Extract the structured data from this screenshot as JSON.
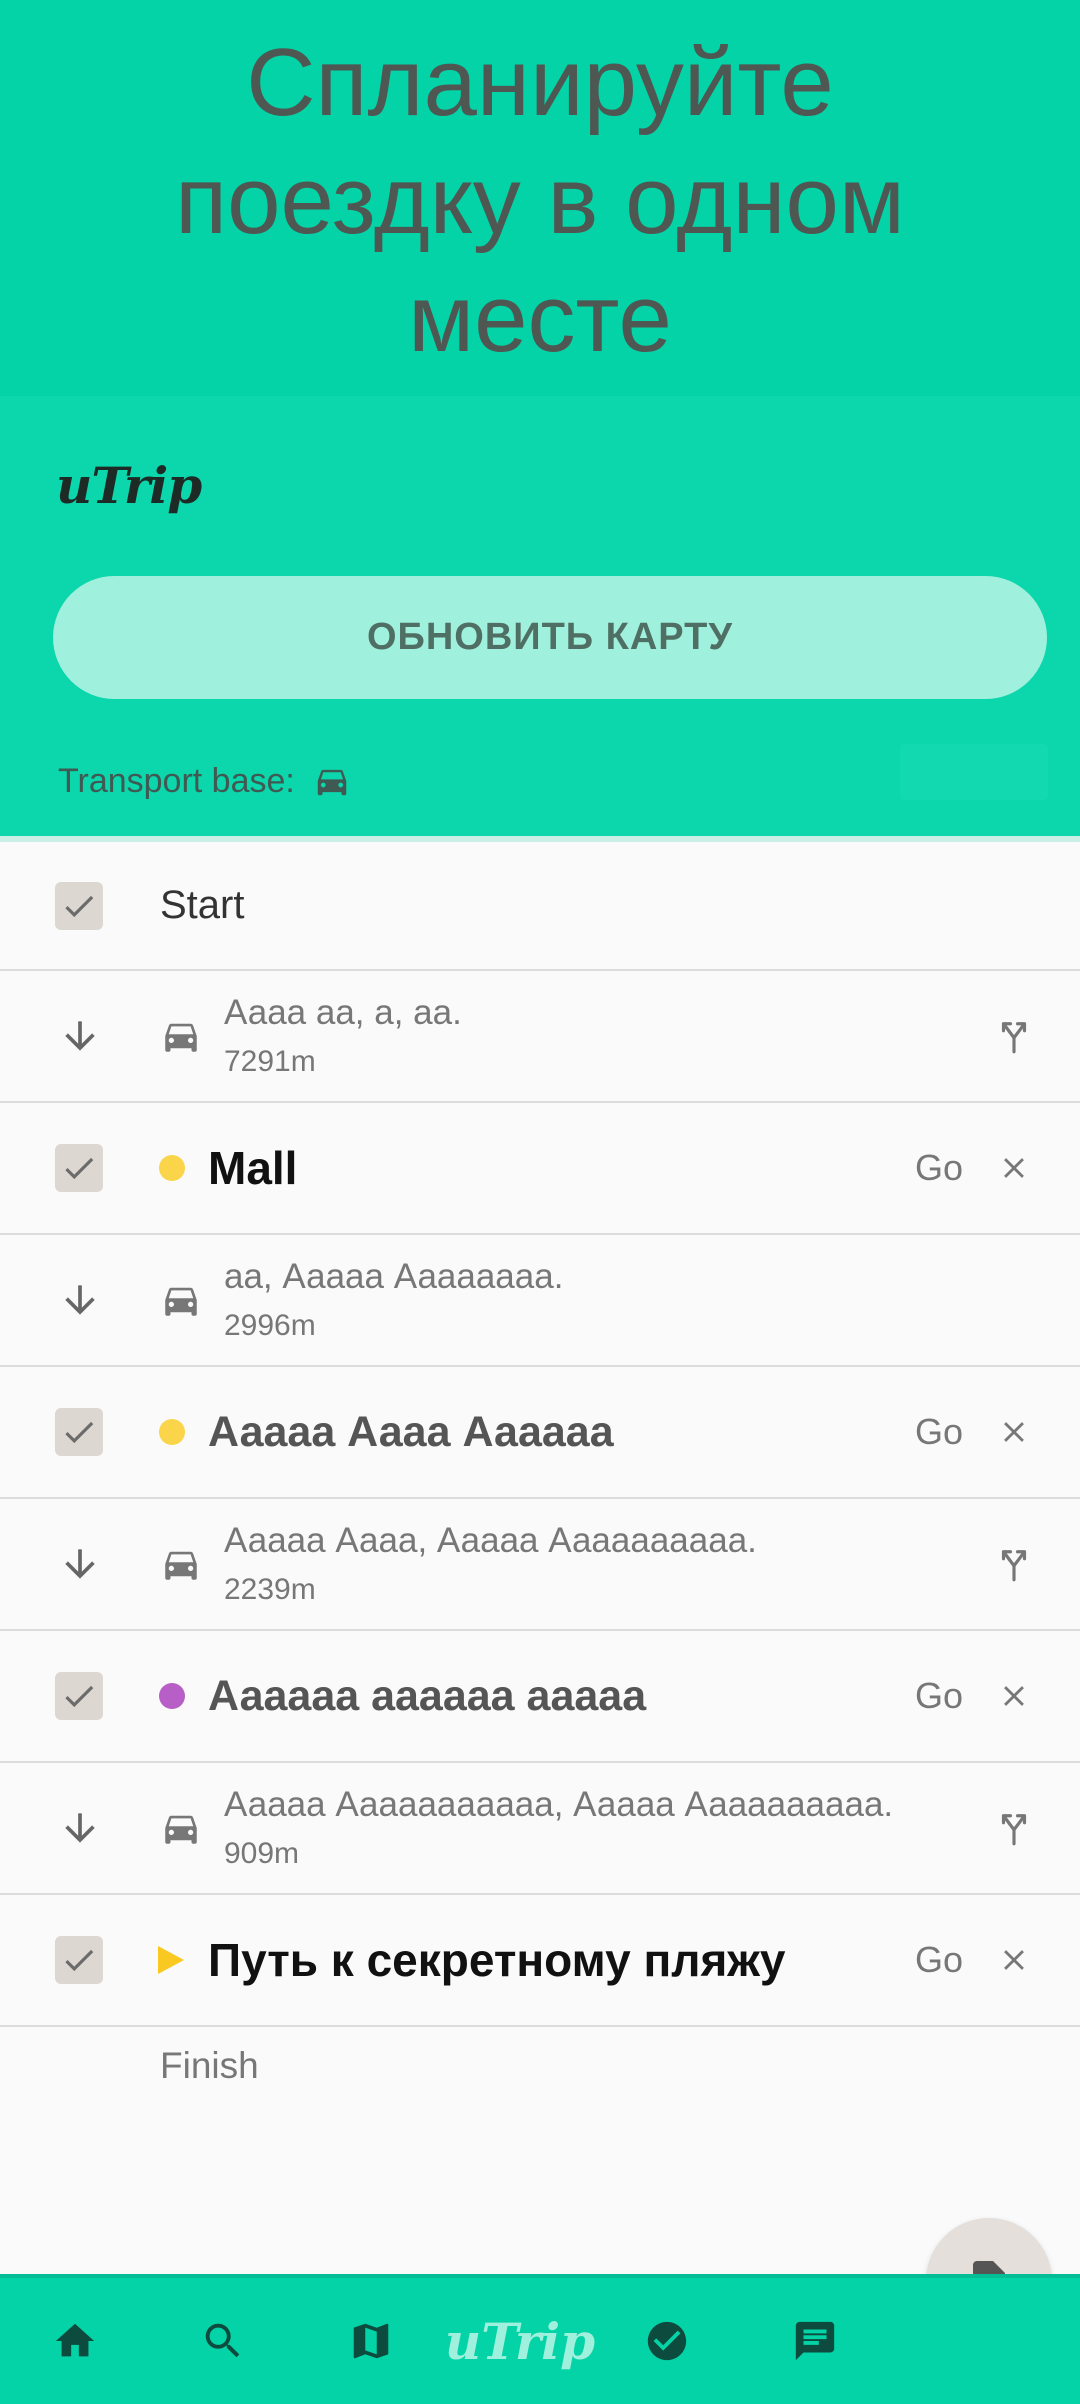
{
  "hero": {
    "title": "Спланируйте поездку в одном месте"
  },
  "header": {
    "logo": "uTrip",
    "update_button": "ОБНОВИТЬ КАРТУ",
    "transport_label": "Transport base:",
    "transport_icon": "car-icon"
  },
  "list": {
    "start": "Start",
    "finish": "Finish",
    "stops": [
      {
        "name": "Mall",
        "marker": "dot",
        "color": "#fad54a",
        "go": "Go"
      },
      {
        "name": "Ааааа Аааа Аааааа",
        "marker": "dot",
        "color": "#fad54a",
        "go": "Go"
      },
      {
        "name": "Аааааа аааааа ааааа",
        "marker": "dot",
        "color": "#b75fc6",
        "go": "Go"
      },
      {
        "name": "Путь к секретному пляжу",
        "marker": "flag",
        "color": "#f9c821",
        "go": "Go"
      }
    ],
    "legs": [
      {
        "desc": "Аааа аа, а, аа.",
        "dist": "7291m",
        "has_fork": true
      },
      {
        "desc": "аа, Ааааа Аааааааа.",
        "dist": "2996m",
        "has_fork": false
      },
      {
        "desc": "Ааааа Аааа, Ааааа Аааааааааа.",
        "dist": "2239m",
        "has_fork": true
      },
      {
        "desc": "Ааааа Ааааааааааа, Ааааа Аааааааааа.",
        "dist": "909m",
        "has_fork": true
      }
    ]
  },
  "bottom_nav": {
    "items": [
      "home-icon",
      "search-icon",
      "map-icon",
      "utrip-logo",
      "check-circle-icon",
      "chat-icon"
    ],
    "logo": "uTrip"
  },
  "colors": {
    "primary": "#03d3a7",
    "button": "#9ff0dc",
    "checkbox": "#ddd7d1"
  }
}
